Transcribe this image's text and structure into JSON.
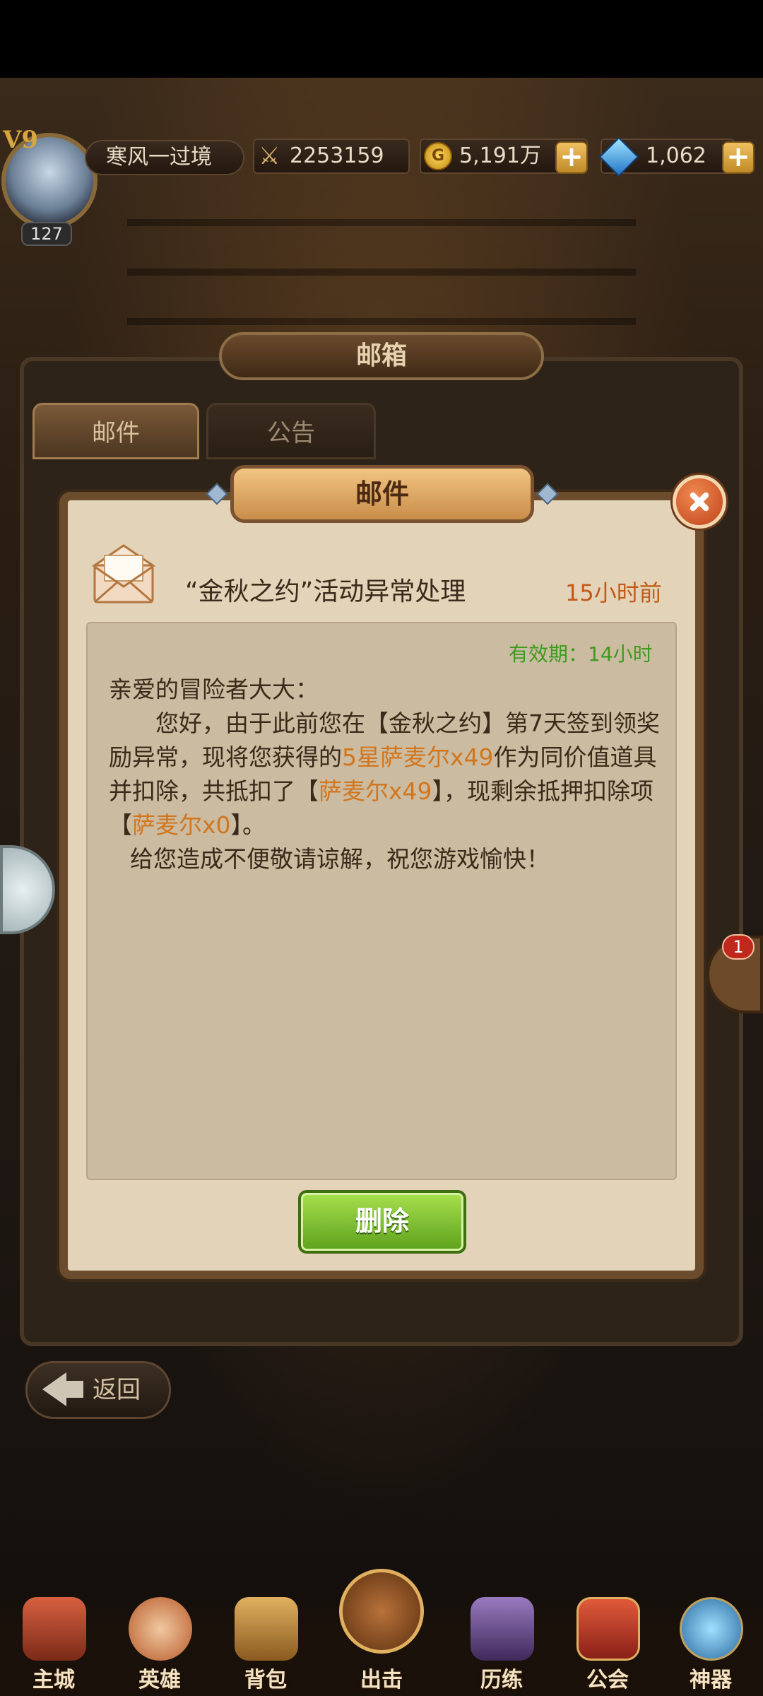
{
  "topbar": {
    "vip": "V9",
    "level": "127",
    "player_name": "寒风一过境",
    "power": "2253159",
    "gold": "5,191万",
    "gems": "1,062"
  },
  "mailbox": {
    "title": "邮箱",
    "tabs": [
      "邮件",
      "公告"
    ],
    "back_label": "返回"
  },
  "dialog": {
    "title": "邮件",
    "subject": "“金秋之约”活动异常处理",
    "time_ago": "15小时前",
    "validity": "有效期：14小时",
    "greeting": "亲爱的冒险者大大：",
    "para1_a": "您好，由于此前您在【金秋之约】第7天签到领奖励异常，现将您获得的",
    "para1_hl1": "5星萨麦尔x49",
    "para1_b": "作为同价值道具并扣除，共抵扣了【",
    "para1_hl2": "萨麦尔x49",
    "para1_c": "】，现剩余抵押扣除项【",
    "para1_hl3": "萨麦尔x0",
    "para1_d": "】。",
    "para2": "给您造成不便敬请谅解，祝您游戏愉快！",
    "delete_label": "删除"
  },
  "side": {
    "badge_count": "1"
  },
  "bottom_nav": [
    "主城",
    "英雄",
    "背包",
    "出击",
    "历练",
    "公会",
    "神器"
  ],
  "colors": {
    "highlight": "#d2761e",
    "time_ago": "#c25a18",
    "validity": "#3d9b1e",
    "delete_button": "#6fb424"
  }
}
